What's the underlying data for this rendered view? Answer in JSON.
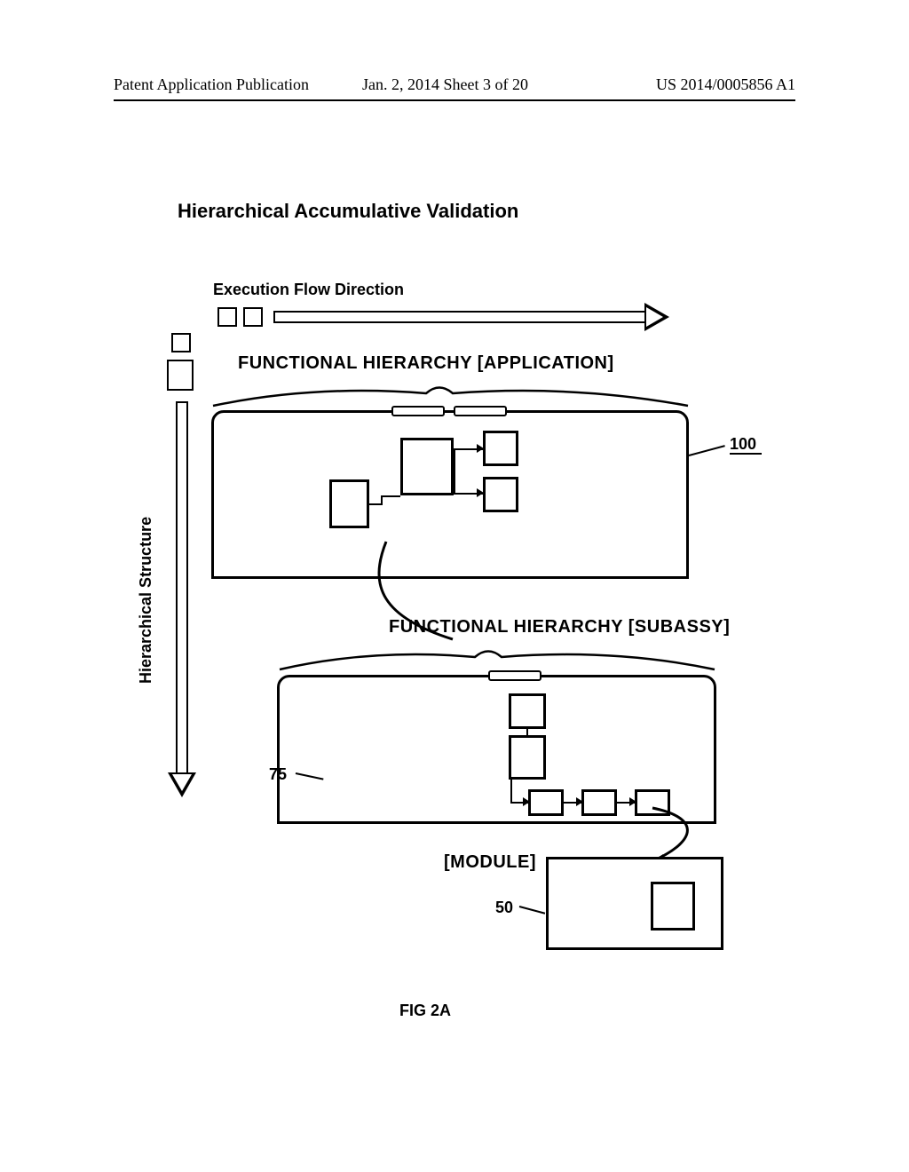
{
  "header": {
    "left": "Patent Application Publication",
    "mid": "Jan. 2, 2014  Sheet 3 of 20",
    "right": "US 2014/0005856 A1"
  },
  "title": "Hierarchical Accumulative  Validation",
  "execLabel": "Execution Flow Direction",
  "vAxisLabel": "Hierarchical Structure",
  "layerApp": "FUNCTIONAL HIERARCHY [APPLICATION]",
  "layerSub": "FUNCTIONAL HIERARCHY [SUBASSY]",
  "layerMod": "[MODULE]",
  "ref": {
    "app": "100",
    "sub": "75",
    "mod": "50"
  },
  "figCaption": "FIG 2A"
}
